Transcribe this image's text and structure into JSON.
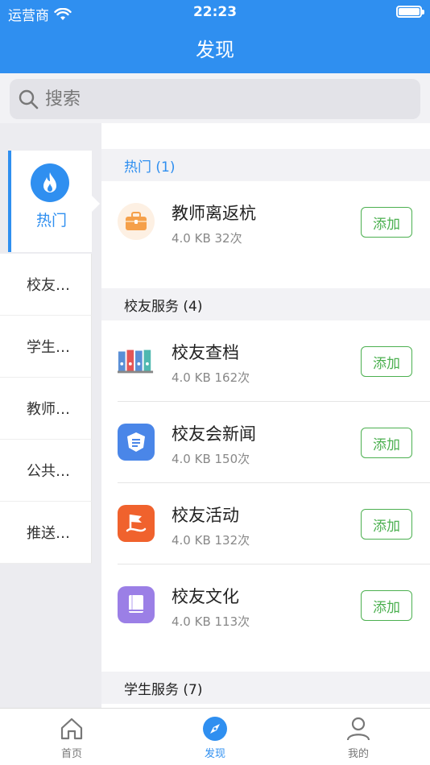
{
  "status_bar": {
    "carrier": "运营商",
    "time": "22:23"
  },
  "header": {
    "title": "发现"
  },
  "search": {
    "placeholder": "搜索"
  },
  "sidebar": {
    "active": {
      "label": "热门"
    },
    "items": [
      {
        "label": "校友…"
      },
      {
        "label": "学生…"
      },
      {
        "label": "教师…"
      },
      {
        "label": "公共…"
      },
      {
        "label": "推送…"
      }
    ]
  },
  "sections": [
    {
      "title": "热门 (1)",
      "rows": [
        {
          "name": "教师离返杭",
          "meta": "4.0 KB 32次",
          "action": "添加",
          "icon": "briefcase-icon"
        }
      ]
    },
    {
      "title": "校友服务 (4)",
      "rows": [
        {
          "name": "校友查档",
          "meta": "4.0 KB 162次",
          "action": "添加",
          "icon": "binders-icon"
        },
        {
          "name": "校友会新闻",
          "meta": "4.0 KB 150次",
          "action": "添加",
          "icon": "news-shield-icon"
        },
        {
          "name": "校友活动",
          "meta": "4.0 KB 132次",
          "action": "添加",
          "icon": "flag-icon"
        },
        {
          "name": "校友文化",
          "meta": "4.0 KB 113次",
          "action": "添加",
          "icon": "book-icon"
        }
      ]
    },
    {
      "title": "学生服务 (7)"
    }
  ],
  "tabbar": {
    "tabs": [
      {
        "label": "首页",
        "icon": "home-icon"
      },
      {
        "label": "发现",
        "icon": "compass-icon",
        "active": true
      },
      {
        "label": "我的",
        "icon": "person-icon"
      }
    ]
  },
  "colors": {
    "primary": "#2f8ff0",
    "add_green": "#4cb050"
  }
}
